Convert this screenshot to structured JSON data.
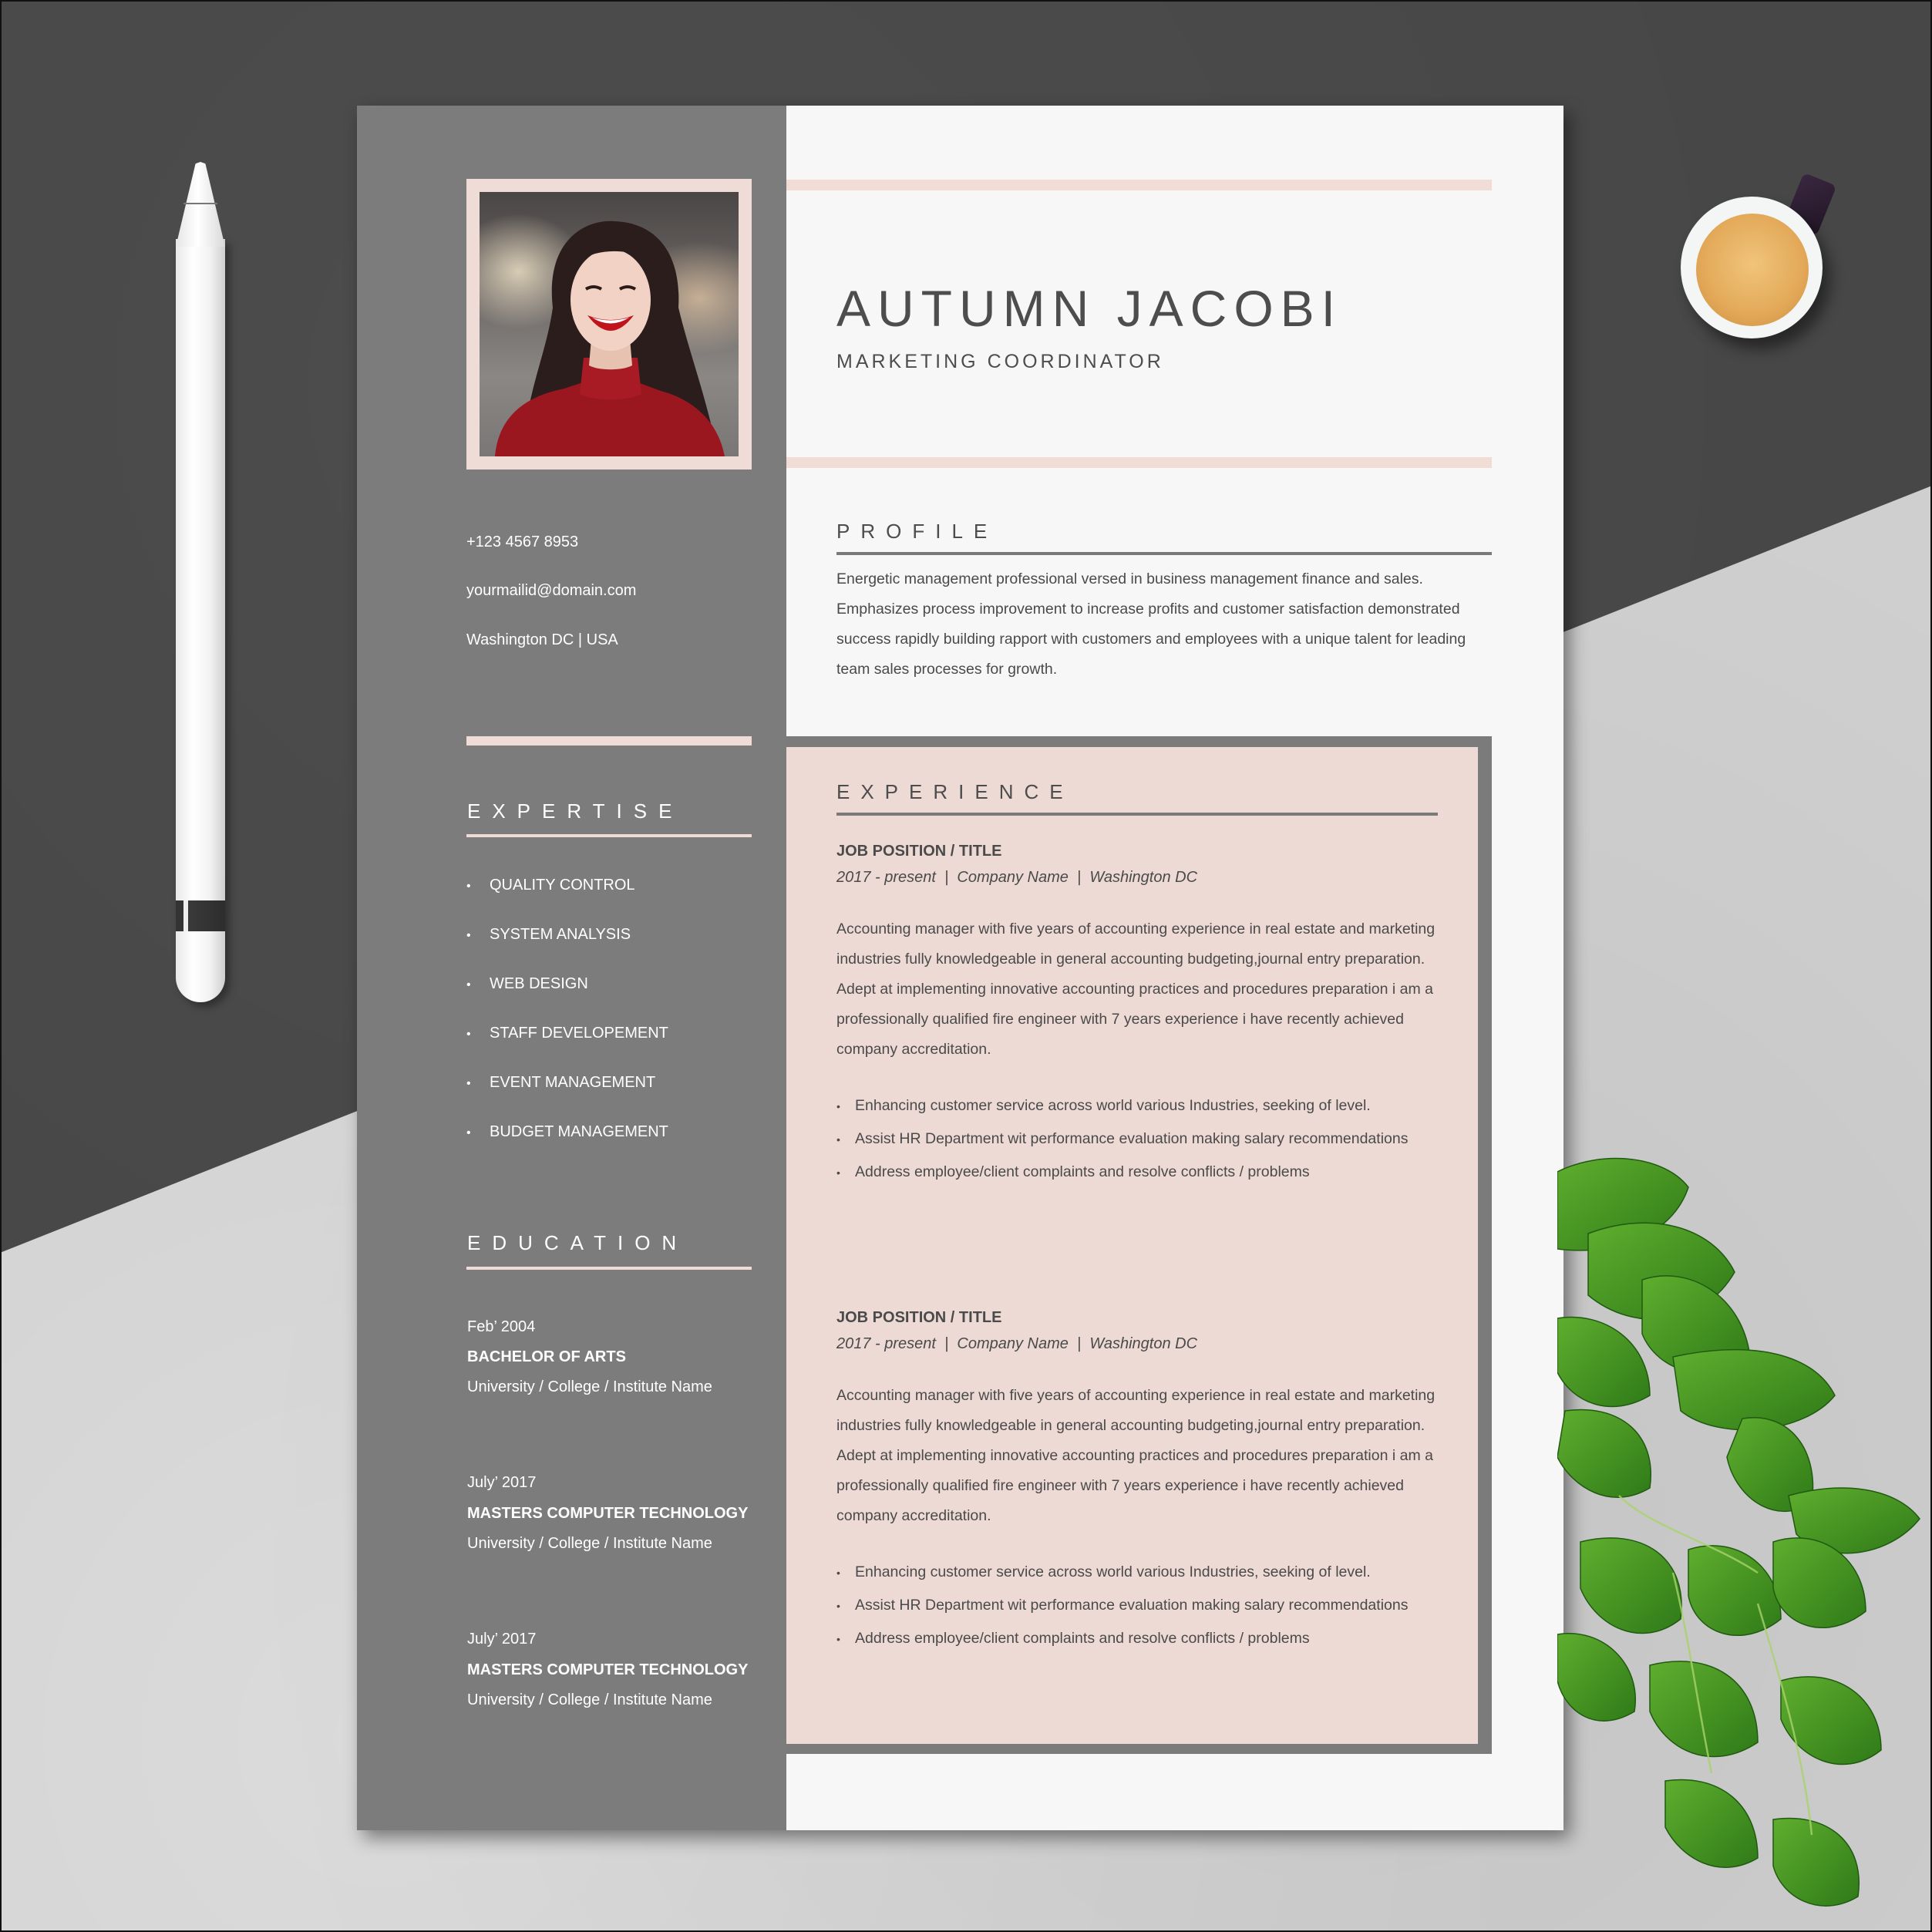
{
  "colors": {
    "sidebar_bg": "#7c7c7c",
    "accent_pink": "#efdcd6",
    "experience_bg": "#eedad5",
    "text_dark": "#4d4d4d",
    "paper": "#f7f7f7"
  },
  "header": {
    "name": "AUTUMN JACOBI",
    "role": "MARKETING COORDINATOR"
  },
  "contact": {
    "phone": "+123 4567 8953",
    "email": "yourmailid@domain.com",
    "location": "Washington DC | USA"
  },
  "expertise": {
    "heading": "EXPERTISE",
    "bullet": "•",
    "items": [
      "QUALITY CONTROL",
      "SYSTEM ANALYSIS",
      "WEB DESIGN",
      "STAFF DEVELOPEMENT",
      "EVENT MANAGEMENT",
      "BUDGET MANAGEMENT"
    ]
  },
  "education": {
    "heading": "EDUCATION",
    "entries": [
      {
        "date": "Feb’ 2004",
        "degree": "BACHELOR OF ARTS",
        "school": "University / College / Institute Name"
      },
      {
        "date": "July’ 2017",
        "degree": "MASTERS COMPUTER TECHNOLOGY",
        "school": "University / College / Institute Name"
      },
      {
        "date": "July’ 2017",
        "degree": "MASTERS COMPUTER TECHNOLOGY",
        "school": "University / College / Institute Name"
      }
    ]
  },
  "profile": {
    "heading": "PROFILE",
    "text": "Energetic management professional versed in business management finance and sales. Emphasizes process improvement to increase profits and customer satisfaction demonstrated success rapidly building rapport with customers and employees with a unique talent for leading team sales processes for growth."
  },
  "experience": {
    "heading": "EXPERIENCE",
    "bullet": "•",
    "jobs": [
      {
        "title": "JOB POSITION / TITLE",
        "meta": "2017 - present  |  Company Name  |  Washington DC",
        "description": "Accounting manager with five years of accounting experience in real estate and marketing industries fully knowledgeable in general accounting budgeting,journal entry preparation. Adept at implementing innovative accounting practices and procedures preparation i am a professionally qualified fire engineer with 7 years experience i have recently achieved company accreditation.",
        "bullets": [
          "Enhancing customer service across world various Industries, seeking of  level.",
          "Assist HR Department wit performance evaluation making salary recommendations",
          "Address employee/client complaints and resolve conflicts / problems"
        ]
      },
      {
        "title": "JOB POSITION / TITLE",
        "meta": "2017 - present  |  Company Name  |  Washington DC",
        "description": "Accounting manager with five years of accounting experience in real estate and marketing industries fully knowledgeable in general accounting budgeting,journal entry preparation. Adept at implementing innovative accounting practices and procedures preparation i am a professionally qualified fire engineer with 7 years experience i have recently achieved company accreditation.",
        "bullets": [
          "Enhancing customer service across world various Industries, seeking of  level.",
          "Assist HR Department wit performance evaluation making salary recommendations",
          "Address employee/client complaints and resolve conflicts / problems"
        ]
      }
    ]
  },
  "scene": {
    "props": [
      "pencil-icon",
      "coffee-cup-icon",
      "plant-icon",
      "profile-photo"
    ]
  }
}
